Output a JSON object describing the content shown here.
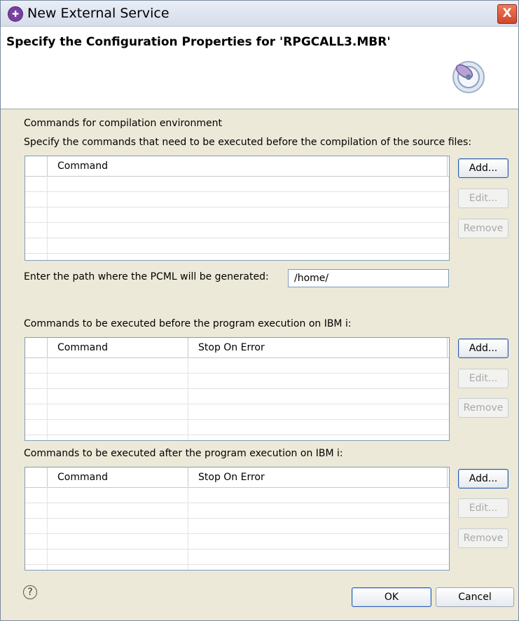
{
  "window": {
    "title": "New External Service",
    "close_label": "X"
  },
  "header": {
    "title": "Specify the Configuration Properties for 'RPGCALL3.MBR'"
  },
  "compile_section": {
    "heading": "Commands for compilation environment",
    "description": "Specify the commands that need to be executed before the compilation of the source files:",
    "columns": [
      "Command"
    ],
    "add": "Add...",
    "edit": "Edit...",
    "remove": "Remove"
  },
  "pcml": {
    "label": "Enter the path where the PCML will be generated:",
    "value": "/home/"
  },
  "before_section": {
    "heading": "Commands to be executed before the program execution on IBM i:",
    "columns": [
      "Command",
      "Stop On Error"
    ],
    "add": "Add...",
    "edit": "Edit...",
    "remove": "Remove"
  },
  "after_section": {
    "heading": "Commands to be executed after the program execution on IBM i:",
    "columns": [
      "Command",
      "Stop On Error"
    ],
    "add": "Add...",
    "edit": "Edit...",
    "remove": "Remove"
  },
  "footer": {
    "help": "?",
    "ok": "OK",
    "cancel": "Cancel"
  }
}
